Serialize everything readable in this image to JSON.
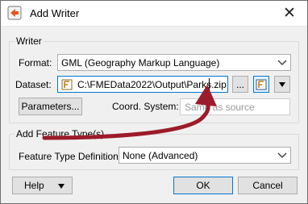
{
  "window": {
    "title": "Add Writer",
    "close_glyph": "✕"
  },
  "writer_group": {
    "legend": "Writer",
    "format": {
      "label": "Format:",
      "value": "GML (Geography Markup Language)"
    },
    "dataset": {
      "label": "Dataset:",
      "value": "C:\\FMEData2022\\Output\\Parks.zip",
      "browse_label": "...",
      "file_type_icon": "fme-file-icon"
    },
    "parameters_label": "Parameters...",
    "coord_system": {
      "label": "Coord. System:",
      "placeholder": "Same as source"
    }
  },
  "feature_group": {
    "legend": "Add Feature Type(s)",
    "definition_label": "Feature Type Definition:",
    "definition_value": "None (Advanced)"
  },
  "buttons": {
    "help": "Help",
    "ok": "OK",
    "cancel": "Cancel"
  },
  "colors": {
    "accent": "#0078d7",
    "annotation_arrow": "#9c1b2a"
  }
}
